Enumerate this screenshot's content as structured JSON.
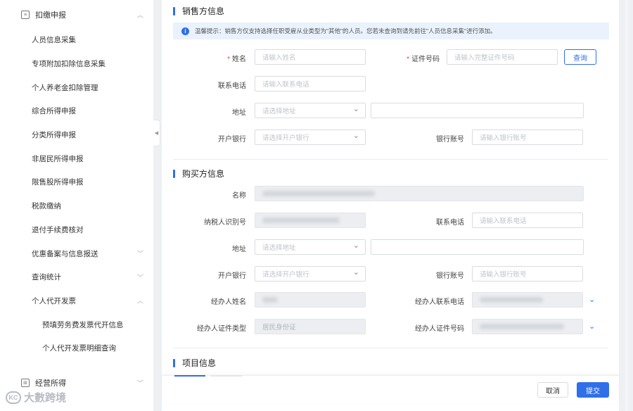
{
  "sidebar": {
    "group1": {
      "label": "扣缴申报",
      "icon": "report-icon"
    },
    "items": [
      {
        "label": "人员信息采集"
      },
      {
        "label": "专项附加扣除信息采集"
      },
      {
        "label": "个人养老金扣除管理"
      },
      {
        "label": "综合所得申报"
      },
      {
        "label": "分类所得申报"
      },
      {
        "label": "非居民所得申报"
      },
      {
        "label": "限售股所得申报"
      },
      {
        "label": "税款缴纳"
      },
      {
        "label": "退付手续费核对"
      },
      {
        "label": "优惠备案与信息报送"
      },
      {
        "label": "查询统计"
      },
      {
        "label": "个人代开发票"
      }
    ],
    "subitems": [
      {
        "label": "预填劳务费发票代开信息"
      },
      {
        "label": "个人代开发票明细查询"
      }
    ],
    "group2": {
      "label": "经营所得",
      "icon": "business-icon"
    }
  },
  "seller": {
    "title": "销售方信息",
    "notice": "温馨提示：销售方仅支持选择任职受雇从业类型为\"其他\"的人员。您若未查询到请先前往\"人员信息采集\"进行添加。",
    "name_label": "姓名",
    "name_placeholder": "请输入姓名",
    "id_label": "证件号码",
    "id_placeholder": "请输入完整证件号码",
    "query_button": "查询",
    "phone_label": "联系电话",
    "phone_placeholder": "请输入联系电话",
    "address_label": "地址",
    "address_placeholder": "请选择地址",
    "bank_label": "开户银行",
    "bank_placeholder": "请选择开户银行",
    "account_label": "银行账号",
    "account_placeholder": "请输入银行账号"
  },
  "buyer": {
    "title": "购买方信息",
    "name_label": "名称",
    "taxid_label": "纳税人识别号",
    "phone_label": "联系电话",
    "phone_placeholder": "请输入联系电话",
    "address_label": "地址",
    "address_placeholder": "请选择地址",
    "bank_label": "开户银行",
    "bank_placeholder": "请选择开户银行",
    "account_label": "银行账号",
    "account_placeholder": "请输入银行账号",
    "agent_name_label": "经办人姓名",
    "agent_phone_label": "经办人联系电话",
    "agent_idtype_label": "经办人证件类型",
    "agent_idtype_value": "居民身份证",
    "agent_id_label": "经办人证件号码"
  },
  "project": {
    "title": "项目信息"
  },
  "footer": {
    "cancel": "取消",
    "submit": "提交"
  },
  "watermark": {
    "text": "大數跨境",
    "logo": "KC"
  }
}
